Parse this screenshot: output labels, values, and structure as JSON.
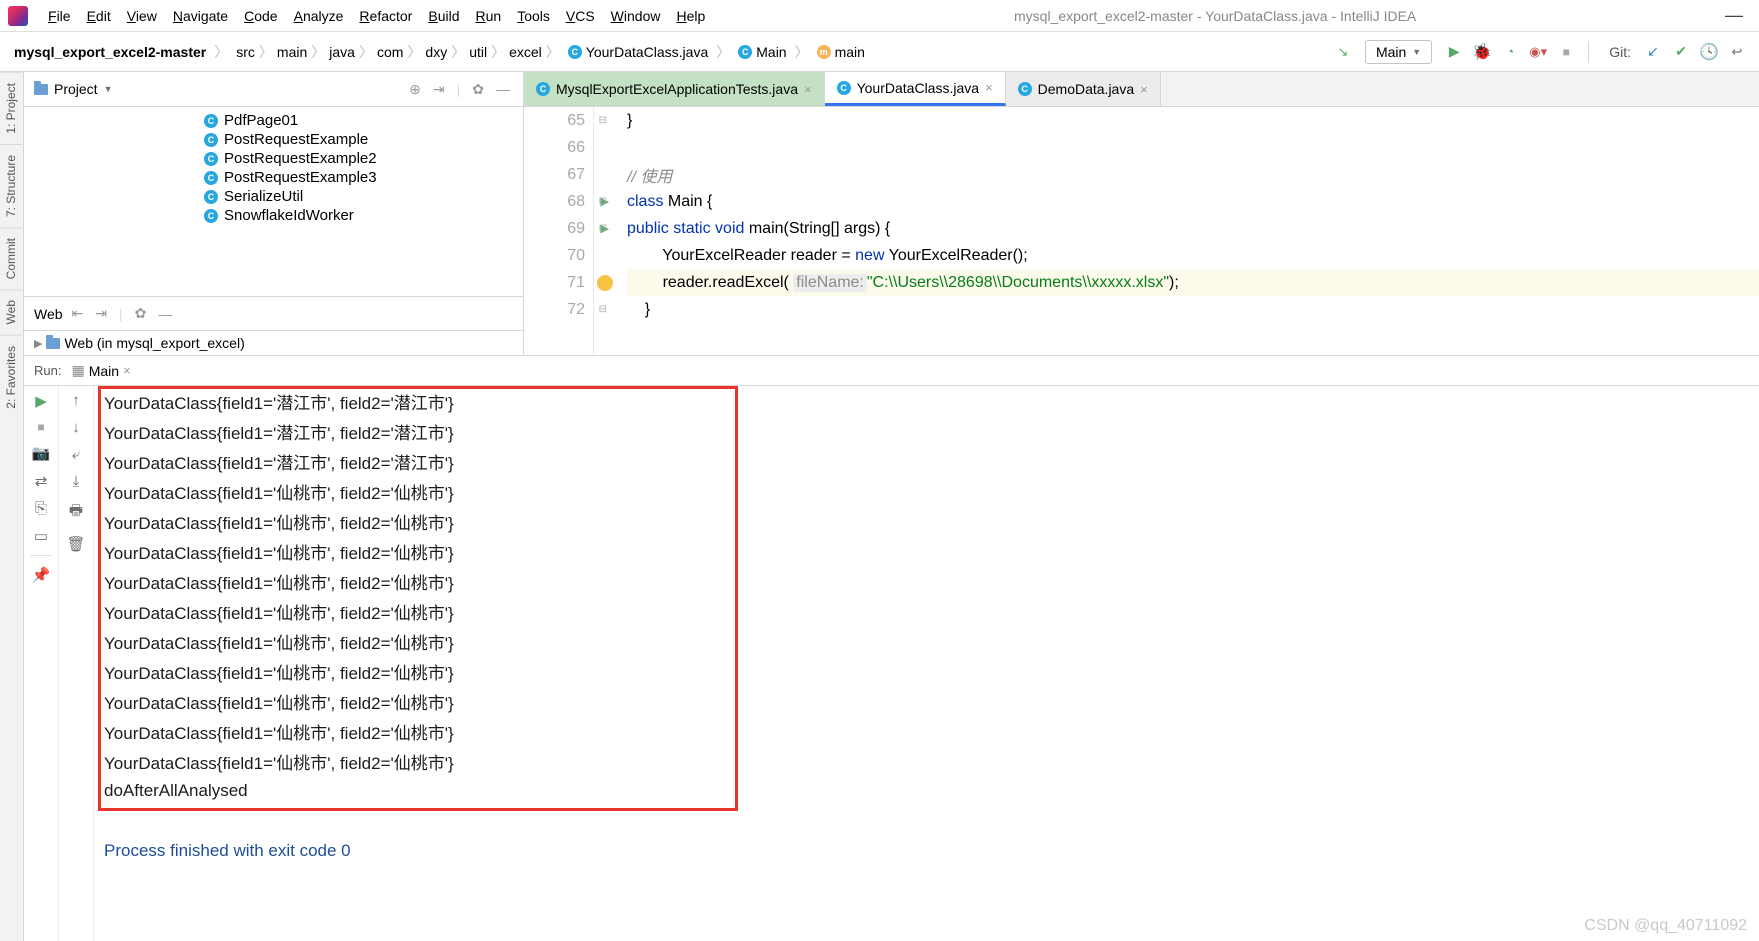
{
  "menu": {
    "items": [
      "File",
      "Edit",
      "View",
      "Navigate",
      "Code",
      "Analyze",
      "Refactor",
      "Build",
      "Run",
      "Tools",
      "VCS",
      "Window",
      "Help"
    ],
    "title": "mysql_export_excel2-master - YourDataClass.java - IntelliJ IDEA"
  },
  "breadcrumb": {
    "root": "mysql_export_excel2-master",
    "parts": [
      "src",
      "main",
      "java",
      "com",
      "dxy",
      "util",
      "excel"
    ],
    "file": "YourDataClass.java",
    "klass": "Main",
    "method": "main"
  },
  "runConfig": {
    "name": "Main"
  },
  "git": {
    "label": "Git:"
  },
  "leftStrip": {
    "items": [
      "1: Project",
      "7: Structure",
      "Commit",
      "Web",
      "2: Favorites"
    ],
    "activeIndex": 1
  },
  "projectPanel": {
    "title": "Project",
    "treeItems": [
      "PdfPage01",
      "PostRequestExample",
      "PostRequestExample2",
      "PostRequestExample3",
      "SerializeUtil",
      "SnowflakeIdWorker"
    ]
  },
  "webPanel": {
    "title": "Web",
    "treeLabel": "Web (in mysql_export_excel)"
  },
  "tabs": [
    {
      "label": "MysqlExportExcelApplicationTests.java",
      "state": "alt"
    },
    {
      "label": "YourDataClass.java",
      "state": "active"
    },
    {
      "label": "DemoData.java",
      "state": "normal"
    }
  ],
  "editor": {
    "lines": [
      {
        "no": 65,
        "html": "}"
      },
      {
        "no": 66,
        "html": ""
      },
      {
        "no": 67,
        "html": "<span class='cmt'>// 使用</span>"
      },
      {
        "no": 68,
        "html": "<span class='kw'>class</span> Main {",
        "play": true
      },
      {
        "no": 69,
        "html": "    <span class='kw'>public static void</span> main(String[] args) {",
        "play": true
      },
      {
        "no": 70,
        "html": "        YourExcelReader reader = <span class='kw'>new</span> YourExcelReader();"
      },
      {
        "no": 71,
        "html": "        reader.readExcel( <span class='param'>fileName:</span> <span class='str'>\"C:\\\\Users\\\\28698\\\\Documents\\\\xxxxx.xlsx\"</span>);",
        "hl": true,
        "bulb": true
      },
      {
        "no": 72,
        "html": "    }"
      }
    ]
  },
  "runPanel": {
    "label": "Run:",
    "config": "Main",
    "console": [
      "YourDataClass{field1='潜江市', field2='潜江市'}",
      "YourDataClass{field1='潜江市', field2='潜江市'}",
      "YourDataClass{field1='潜江市', field2='潜江市'}",
      "YourDataClass{field1='仙桃市', field2='仙桃市'}",
      "YourDataClass{field1='仙桃市', field2='仙桃市'}",
      "YourDataClass{field1='仙桃市', field2='仙桃市'}",
      "YourDataClass{field1='仙桃市', field2='仙桃市'}",
      "YourDataClass{field1='仙桃市', field2='仙桃市'}",
      "YourDataClass{field1='仙桃市', field2='仙桃市'}",
      "YourDataClass{field1='仙桃市', field2='仙桃市'}",
      "YourDataClass{field1='仙桃市', field2='仙桃市'}",
      "YourDataClass{field1='仙桃市', field2='仙桃市'}",
      "YourDataClass{field1='仙桃市', field2='仙桃市'}",
      "doAfterAllAnalysed",
      "",
      "Process finished with exit code 0"
    ]
  },
  "watermark": "CSDN @qq_40711092"
}
